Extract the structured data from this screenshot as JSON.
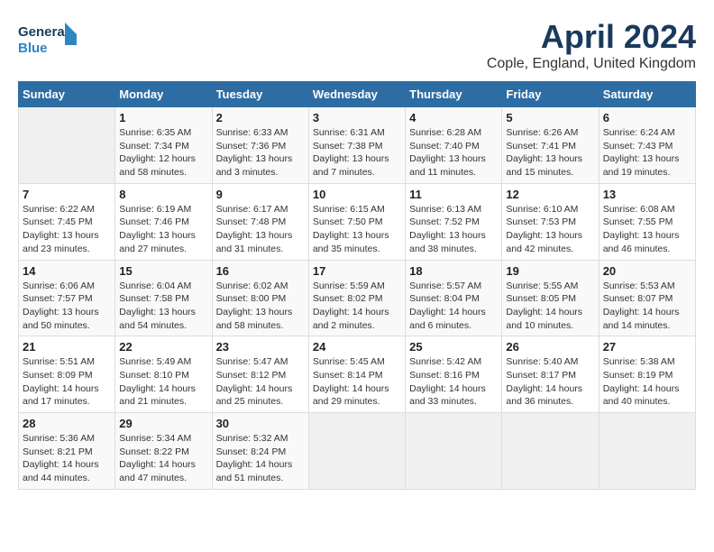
{
  "logo": {
    "line1": "General",
    "line2": "Blue"
  },
  "title": "April 2024",
  "subtitle": "Cople, England, United Kingdom",
  "days_of_week": [
    "Sunday",
    "Monday",
    "Tuesday",
    "Wednesday",
    "Thursday",
    "Friday",
    "Saturday"
  ],
  "weeks": [
    [
      {
        "num": "",
        "sunrise": "",
        "sunset": "",
        "daylight": ""
      },
      {
        "num": "1",
        "sunrise": "Sunrise: 6:35 AM",
        "sunset": "Sunset: 7:34 PM",
        "daylight": "Daylight: 12 hours and 58 minutes."
      },
      {
        "num": "2",
        "sunrise": "Sunrise: 6:33 AM",
        "sunset": "Sunset: 7:36 PM",
        "daylight": "Daylight: 13 hours and 3 minutes."
      },
      {
        "num": "3",
        "sunrise": "Sunrise: 6:31 AM",
        "sunset": "Sunset: 7:38 PM",
        "daylight": "Daylight: 13 hours and 7 minutes."
      },
      {
        "num": "4",
        "sunrise": "Sunrise: 6:28 AM",
        "sunset": "Sunset: 7:40 PM",
        "daylight": "Daylight: 13 hours and 11 minutes."
      },
      {
        "num": "5",
        "sunrise": "Sunrise: 6:26 AM",
        "sunset": "Sunset: 7:41 PM",
        "daylight": "Daylight: 13 hours and 15 minutes."
      },
      {
        "num": "6",
        "sunrise": "Sunrise: 6:24 AM",
        "sunset": "Sunset: 7:43 PM",
        "daylight": "Daylight: 13 hours and 19 minutes."
      }
    ],
    [
      {
        "num": "7",
        "sunrise": "Sunrise: 6:22 AM",
        "sunset": "Sunset: 7:45 PM",
        "daylight": "Daylight: 13 hours and 23 minutes."
      },
      {
        "num": "8",
        "sunrise": "Sunrise: 6:19 AM",
        "sunset": "Sunset: 7:46 PM",
        "daylight": "Daylight: 13 hours and 27 minutes."
      },
      {
        "num": "9",
        "sunrise": "Sunrise: 6:17 AM",
        "sunset": "Sunset: 7:48 PM",
        "daylight": "Daylight: 13 hours and 31 minutes."
      },
      {
        "num": "10",
        "sunrise": "Sunrise: 6:15 AM",
        "sunset": "Sunset: 7:50 PM",
        "daylight": "Daylight: 13 hours and 35 minutes."
      },
      {
        "num": "11",
        "sunrise": "Sunrise: 6:13 AM",
        "sunset": "Sunset: 7:52 PM",
        "daylight": "Daylight: 13 hours and 38 minutes."
      },
      {
        "num": "12",
        "sunrise": "Sunrise: 6:10 AM",
        "sunset": "Sunset: 7:53 PM",
        "daylight": "Daylight: 13 hours and 42 minutes."
      },
      {
        "num": "13",
        "sunrise": "Sunrise: 6:08 AM",
        "sunset": "Sunset: 7:55 PM",
        "daylight": "Daylight: 13 hours and 46 minutes."
      }
    ],
    [
      {
        "num": "14",
        "sunrise": "Sunrise: 6:06 AM",
        "sunset": "Sunset: 7:57 PM",
        "daylight": "Daylight: 13 hours and 50 minutes."
      },
      {
        "num": "15",
        "sunrise": "Sunrise: 6:04 AM",
        "sunset": "Sunset: 7:58 PM",
        "daylight": "Daylight: 13 hours and 54 minutes."
      },
      {
        "num": "16",
        "sunrise": "Sunrise: 6:02 AM",
        "sunset": "Sunset: 8:00 PM",
        "daylight": "Daylight: 13 hours and 58 minutes."
      },
      {
        "num": "17",
        "sunrise": "Sunrise: 5:59 AM",
        "sunset": "Sunset: 8:02 PM",
        "daylight": "Daylight: 14 hours and 2 minutes."
      },
      {
        "num": "18",
        "sunrise": "Sunrise: 5:57 AM",
        "sunset": "Sunset: 8:04 PM",
        "daylight": "Daylight: 14 hours and 6 minutes."
      },
      {
        "num": "19",
        "sunrise": "Sunrise: 5:55 AM",
        "sunset": "Sunset: 8:05 PM",
        "daylight": "Daylight: 14 hours and 10 minutes."
      },
      {
        "num": "20",
        "sunrise": "Sunrise: 5:53 AM",
        "sunset": "Sunset: 8:07 PM",
        "daylight": "Daylight: 14 hours and 14 minutes."
      }
    ],
    [
      {
        "num": "21",
        "sunrise": "Sunrise: 5:51 AM",
        "sunset": "Sunset: 8:09 PM",
        "daylight": "Daylight: 14 hours and 17 minutes."
      },
      {
        "num": "22",
        "sunrise": "Sunrise: 5:49 AM",
        "sunset": "Sunset: 8:10 PM",
        "daylight": "Daylight: 14 hours and 21 minutes."
      },
      {
        "num": "23",
        "sunrise": "Sunrise: 5:47 AM",
        "sunset": "Sunset: 8:12 PM",
        "daylight": "Daylight: 14 hours and 25 minutes."
      },
      {
        "num": "24",
        "sunrise": "Sunrise: 5:45 AM",
        "sunset": "Sunset: 8:14 PM",
        "daylight": "Daylight: 14 hours and 29 minutes."
      },
      {
        "num": "25",
        "sunrise": "Sunrise: 5:42 AM",
        "sunset": "Sunset: 8:16 PM",
        "daylight": "Daylight: 14 hours and 33 minutes."
      },
      {
        "num": "26",
        "sunrise": "Sunrise: 5:40 AM",
        "sunset": "Sunset: 8:17 PM",
        "daylight": "Daylight: 14 hours and 36 minutes."
      },
      {
        "num": "27",
        "sunrise": "Sunrise: 5:38 AM",
        "sunset": "Sunset: 8:19 PM",
        "daylight": "Daylight: 14 hours and 40 minutes."
      }
    ],
    [
      {
        "num": "28",
        "sunrise": "Sunrise: 5:36 AM",
        "sunset": "Sunset: 8:21 PM",
        "daylight": "Daylight: 14 hours and 44 minutes."
      },
      {
        "num": "29",
        "sunrise": "Sunrise: 5:34 AM",
        "sunset": "Sunset: 8:22 PM",
        "daylight": "Daylight: 14 hours and 47 minutes."
      },
      {
        "num": "30",
        "sunrise": "Sunrise: 5:32 AM",
        "sunset": "Sunset: 8:24 PM",
        "daylight": "Daylight: 14 hours and 51 minutes."
      },
      {
        "num": "",
        "sunrise": "",
        "sunset": "",
        "daylight": ""
      },
      {
        "num": "",
        "sunrise": "",
        "sunset": "",
        "daylight": ""
      },
      {
        "num": "",
        "sunrise": "",
        "sunset": "",
        "daylight": ""
      },
      {
        "num": "",
        "sunrise": "",
        "sunset": "",
        "daylight": ""
      }
    ]
  ]
}
